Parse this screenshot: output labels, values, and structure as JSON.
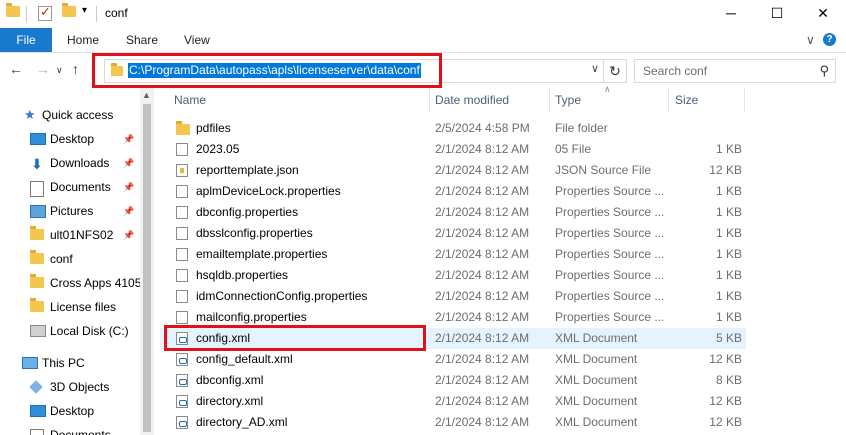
{
  "window": {
    "title": "conf",
    "minimize": "─",
    "maximize": "☐",
    "close": "✕"
  },
  "ribbon": {
    "file": "File",
    "home": "Home",
    "share": "Share",
    "view": "View",
    "collapse": "∨",
    "help": "?"
  },
  "address": {
    "path": "C:\\ProgramData\\autopass\\apls\\licenseserver\\data\\conf",
    "search_placeholder": "Search conf"
  },
  "nav": {
    "quick_access": "Quick access",
    "items": [
      {
        "label": "Desktop",
        "icon": "desktop-icon",
        "pinned": true
      },
      {
        "label": "Downloads",
        "icon": "download-icon",
        "pinned": true
      },
      {
        "label": "Documents",
        "icon": "documents-icon",
        "pinned": true
      },
      {
        "label": "Pictures",
        "icon": "pictures-icon",
        "pinned": true
      },
      {
        "label": "ult01NFS02",
        "icon": "folder-icon",
        "pinned": true
      },
      {
        "label": "conf",
        "icon": "folder-icon",
        "pinned": false
      },
      {
        "label": "Cross Apps 4105",
        "icon": "folder-icon",
        "pinned": false
      },
      {
        "label": "License files",
        "icon": "folder-icon",
        "pinned": false
      },
      {
        "label": "Local Disk (C:)",
        "icon": "disk-icon",
        "pinned": false
      }
    ],
    "this_pc": "This PC",
    "pc_items": [
      {
        "label": "3D Objects",
        "icon": "3d-objects-icon"
      },
      {
        "label": "Desktop",
        "icon": "desktop-icon"
      },
      {
        "label": "Documents",
        "icon": "documents-icon"
      }
    ]
  },
  "columns": {
    "name": "Name",
    "date": "Date modified",
    "type": "Type",
    "size": "Size"
  },
  "files": [
    {
      "name": "pdfiles",
      "date": "2/5/2024 4:58 PM",
      "type": "File folder",
      "size": "",
      "icon": "folder"
    },
    {
      "name": "2023.05",
      "date": "2/1/2024 8:12 AM",
      "type": "05 File",
      "size": "1 KB",
      "icon": "doc"
    },
    {
      "name": "reporttemplate.json",
      "date": "2/1/2024 8:12 AM",
      "type": "JSON Source File",
      "size": "12 KB",
      "icon": "json"
    },
    {
      "name": "aplmDeviceLock.properties",
      "date": "2/1/2024 8:12 AM",
      "type": "Properties Source ...",
      "size": "1 KB",
      "icon": "doc"
    },
    {
      "name": "dbconfig.properties",
      "date": "2/1/2024 8:12 AM",
      "type": "Properties Source ...",
      "size": "1 KB",
      "icon": "doc"
    },
    {
      "name": "dbsslconfig.properties",
      "date": "2/1/2024 8:12 AM",
      "type": "Properties Source ...",
      "size": "1 KB",
      "icon": "doc"
    },
    {
      "name": "emailtemplate.properties",
      "date": "2/1/2024 8:12 AM",
      "type": "Properties Source ...",
      "size": "1 KB",
      "icon": "doc"
    },
    {
      "name": "hsqldb.properties",
      "date": "2/1/2024 8:12 AM",
      "type": "Properties Source ...",
      "size": "1 KB",
      "icon": "doc"
    },
    {
      "name": "idmConnectionConfig.properties",
      "date": "2/1/2024 8:12 AM",
      "type": "Properties Source ...",
      "size": "1 KB",
      "icon": "doc"
    },
    {
      "name": "mailconfig.properties",
      "date": "2/1/2024 8:12 AM",
      "type": "Properties Source ...",
      "size": "1 KB",
      "icon": "doc"
    },
    {
      "name": "config.xml",
      "date": "2/1/2024 8:12 AM",
      "type": "XML Document",
      "size": "5 KB",
      "icon": "xml",
      "selected": true
    },
    {
      "name": "config_default.xml",
      "date": "2/1/2024 8:12 AM",
      "type": "XML Document",
      "size": "12 KB",
      "icon": "xml"
    },
    {
      "name": "dbconfig.xml",
      "date": "2/1/2024 8:12 AM",
      "type": "XML Document",
      "size": "8 KB",
      "icon": "xml"
    },
    {
      "name": "directory.xml",
      "date": "2/1/2024 8:12 AM",
      "type": "XML Document",
      "size": "12 KB",
      "icon": "xml"
    },
    {
      "name": "directory_AD.xml",
      "date": "2/1/2024 8:12 AM",
      "type": "XML Document",
      "size": "12 KB",
      "icon": "xml"
    }
  ],
  "colors": {
    "accent": "#1979ca",
    "highlight": "#e0111b",
    "selection": "#e5f3ff"
  }
}
